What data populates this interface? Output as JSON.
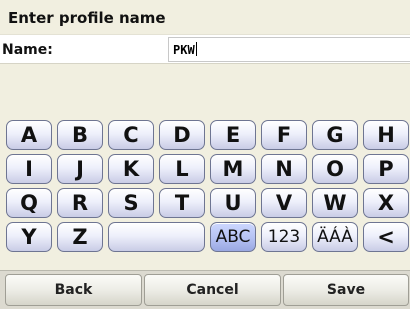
{
  "header": {
    "title": "Enter profile name"
  },
  "name_field": {
    "label": "Name:",
    "value": "PKW"
  },
  "keyboard": {
    "rows": [
      [
        "A",
        "B",
        "C",
        "D",
        "E",
        "F",
        "G",
        "H"
      ],
      [
        "I",
        "J",
        "K",
        "L",
        "M",
        "N",
        "O",
        "P"
      ],
      [
        "Q",
        "R",
        "S",
        "T",
        "U",
        "V",
        "W",
        "X"
      ]
    ],
    "last_row": {
      "y": "Y",
      "z": "Z",
      "space": "",
      "abc": "ABC",
      "num": "123",
      "accents": "ÄÁÀ",
      "backspace": "<"
    },
    "active_mode": "ABC"
  },
  "buttons": {
    "back": "Back",
    "cancel": "Cancel",
    "save": "Save"
  }
}
